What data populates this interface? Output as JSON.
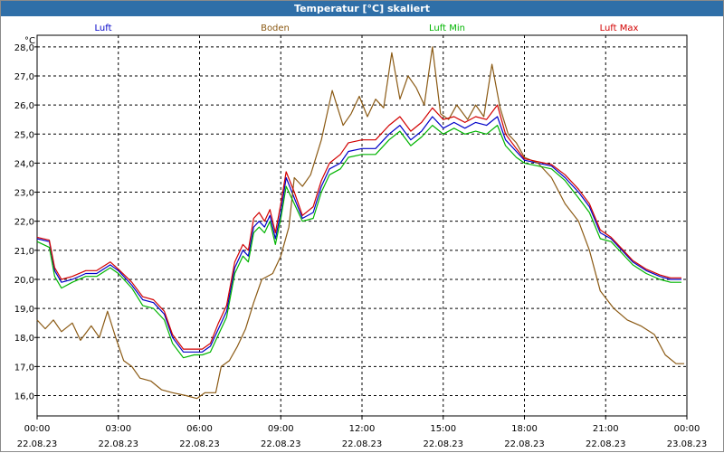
{
  "window": {
    "title": "Temperatur [°C] skaliert"
  },
  "chart_data": {
    "type": "line",
    "title": "Temperatur [°C] skaliert",
    "ylabel": "°C",
    "ylim": [
      15.3,
      28.4
    ],
    "xlim": [
      0,
      24
    ],
    "grid": true,
    "legend": "top",
    "yticks": [
      {
        "value": 16,
        "label": "16,0"
      },
      {
        "value": 17,
        "label": "17,0"
      },
      {
        "value": 18,
        "label": "18,0"
      },
      {
        "value": 19,
        "label": "19,0"
      },
      {
        "value": 20,
        "label": "20,0"
      },
      {
        "value": 21,
        "label": "21,0"
      },
      {
        "value": 22,
        "label": "22,0"
      },
      {
        "value": 23,
        "label": "23,0"
      },
      {
        "value": 24,
        "label": "24,0"
      },
      {
        "value": 25,
        "label": "25,0"
      },
      {
        "value": 26,
        "label": "26,0"
      },
      {
        "value": 27,
        "label": "27,0"
      },
      {
        "value": 28,
        "label": "28,0"
      }
    ],
    "xticks": [
      {
        "value": 0,
        "time": "00:00",
        "date": "22.08.23"
      },
      {
        "value": 3,
        "time": "03:00",
        "date": "22.08.23"
      },
      {
        "value": 6,
        "time": "06:00",
        "date": "22.08.23"
      },
      {
        "value": 9,
        "time": "09:00",
        "date": "22.08.23"
      },
      {
        "value": 12,
        "time": "12:00",
        "date": "22.08.23"
      },
      {
        "value": 15,
        "time": "15:00",
        "date": "22.08.23"
      },
      {
        "value": 18,
        "time": "18:00",
        "date": "22.08.23"
      },
      {
        "value": 21,
        "time": "21:00",
        "date": "22.08.23"
      },
      {
        "value": 24,
        "time": "00:00",
        "date": "23.08.23"
      }
    ],
    "series": [
      {
        "name": "Luft",
        "color": "#0000c8",
        "points": [
          [
            0,
            21.4
          ],
          [
            0.45,
            21.3
          ],
          [
            0.65,
            20.3
          ],
          [
            0.9,
            19.9
          ],
          [
            1.3,
            20.0
          ],
          [
            1.8,
            20.2
          ],
          [
            2.2,
            20.2
          ],
          [
            2.7,
            20.5
          ],
          [
            3.0,
            20.3
          ],
          [
            3.5,
            19.8
          ],
          [
            3.9,
            19.3
          ],
          [
            4.3,
            19.2
          ],
          [
            4.7,
            18.8
          ],
          [
            5.0,
            18.0
          ],
          [
            5.4,
            17.5
          ],
          [
            5.8,
            17.5
          ],
          [
            6.1,
            17.5
          ],
          [
            6.4,
            17.7
          ],
          [
            6.7,
            18.3
          ],
          [
            7.0,
            18.9
          ],
          [
            7.3,
            20.4
          ],
          [
            7.6,
            21.0
          ],
          [
            7.8,
            20.8
          ],
          [
            8.0,
            21.8
          ],
          [
            8.2,
            22.0
          ],
          [
            8.4,
            21.8
          ],
          [
            8.6,
            22.2
          ],
          [
            8.8,
            21.4
          ],
          [
            9.0,
            22.3
          ],
          [
            9.2,
            23.5
          ],
          [
            9.5,
            22.8
          ],
          [
            9.8,
            22.1
          ],
          [
            10.2,
            22.3
          ],
          [
            10.5,
            23.2
          ],
          [
            10.8,
            23.8
          ],
          [
            11.2,
            24.0
          ],
          [
            11.5,
            24.4
          ],
          [
            12.0,
            24.5
          ],
          [
            12.5,
            24.5
          ],
          [
            13.0,
            25.0
          ],
          [
            13.4,
            25.3
          ],
          [
            13.8,
            24.8
          ],
          [
            14.2,
            25.1
          ],
          [
            14.6,
            25.6
          ],
          [
            15.0,
            25.2
          ],
          [
            15.4,
            25.4
          ],
          [
            15.8,
            25.2
          ],
          [
            16.2,
            25.4
          ],
          [
            16.6,
            25.3
          ],
          [
            17.0,
            25.6
          ],
          [
            17.3,
            24.8
          ],
          [
            17.7,
            24.4
          ],
          [
            18.0,
            24.1
          ],
          [
            18.5,
            24.0
          ],
          [
            19.0,
            23.9
          ],
          [
            19.5,
            23.5
          ],
          [
            20.0,
            23.0
          ],
          [
            20.4,
            22.5
          ],
          [
            20.8,
            21.6
          ],
          [
            21.2,
            21.4
          ],
          [
            21.6,
            21.0
          ],
          [
            22.0,
            20.6
          ],
          [
            22.5,
            20.3
          ],
          [
            23.0,
            20.1
          ],
          [
            23.4,
            20.0
          ],
          [
            23.8,
            20.0
          ]
        ]
      },
      {
        "name": "Boden",
        "color": "#8b5a14",
        "points": [
          [
            0,
            18.6
          ],
          [
            0.3,
            18.3
          ],
          [
            0.6,
            18.6
          ],
          [
            0.9,
            18.2
          ],
          [
            1.3,
            18.5
          ],
          [
            1.6,
            17.9
          ],
          [
            2.0,
            18.4
          ],
          [
            2.3,
            18.0
          ],
          [
            2.6,
            18.9
          ],
          [
            2.9,
            18.0
          ],
          [
            3.2,
            17.2
          ],
          [
            3.5,
            17.0
          ],
          [
            3.8,
            16.6
          ],
          [
            4.2,
            16.5
          ],
          [
            4.6,
            16.2
          ],
          [
            5.0,
            16.1
          ],
          [
            5.5,
            16.0
          ],
          [
            5.9,
            15.9
          ],
          [
            6.2,
            16.1
          ],
          [
            6.6,
            16.1
          ],
          [
            6.8,
            17.0
          ],
          [
            7.1,
            17.2
          ],
          [
            7.4,
            17.7
          ],
          [
            7.7,
            18.3
          ],
          [
            8.0,
            19.2
          ],
          [
            8.3,
            20.0
          ],
          [
            8.7,
            20.2
          ],
          [
            9.0,
            20.8
          ],
          [
            9.3,
            21.8
          ],
          [
            9.5,
            23.5
          ],
          [
            9.8,
            23.2
          ],
          [
            10.1,
            23.6
          ],
          [
            10.5,
            24.8
          ],
          [
            10.9,
            26.5
          ],
          [
            11.3,
            25.3
          ],
          [
            11.6,
            25.7
          ],
          [
            11.9,
            26.3
          ],
          [
            12.2,
            25.6
          ],
          [
            12.5,
            26.2
          ],
          [
            12.8,
            25.9
          ],
          [
            13.1,
            27.8
          ],
          [
            13.4,
            26.2
          ],
          [
            13.7,
            27.0
          ],
          [
            14.0,
            26.6
          ],
          [
            14.3,
            26.0
          ],
          [
            14.6,
            28.0
          ],
          [
            14.9,
            25.7
          ],
          [
            15.2,
            25.5
          ],
          [
            15.5,
            26.0
          ],
          [
            15.9,
            25.5
          ],
          [
            16.2,
            26.0
          ],
          [
            16.5,
            25.6
          ],
          [
            16.8,
            27.4
          ],
          [
            17.1,
            25.9
          ],
          [
            17.4,
            25.0
          ],
          [
            17.7,
            24.7
          ],
          [
            18.0,
            24.2
          ],
          [
            18.5,
            24.0
          ],
          [
            19.0,
            23.5
          ],
          [
            19.5,
            22.6
          ],
          [
            20.0,
            22.0
          ],
          [
            20.4,
            21.0
          ],
          [
            20.8,
            19.6
          ],
          [
            21.3,
            19.0
          ],
          [
            21.8,
            18.6
          ],
          [
            22.3,
            18.4
          ],
          [
            22.8,
            18.1
          ],
          [
            23.2,
            17.4
          ],
          [
            23.6,
            17.1
          ],
          [
            23.9,
            17.1
          ]
        ]
      },
      {
        "name": "Luft Min",
        "color": "#00b400",
        "points": [
          [
            0,
            21.3
          ],
          [
            0.45,
            21.1
          ],
          [
            0.65,
            20.1
          ],
          [
            0.9,
            19.7
          ],
          [
            1.3,
            19.9
          ],
          [
            1.8,
            20.1
          ],
          [
            2.2,
            20.1
          ],
          [
            2.7,
            20.4
          ],
          [
            3.0,
            20.2
          ],
          [
            3.5,
            19.7
          ],
          [
            3.9,
            19.1
          ],
          [
            4.3,
            19.0
          ],
          [
            4.7,
            18.6
          ],
          [
            5.0,
            17.8
          ],
          [
            5.4,
            17.3
          ],
          [
            5.8,
            17.4
          ],
          [
            6.1,
            17.4
          ],
          [
            6.4,
            17.5
          ],
          [
            6.7,
            18.1
          ],
          [
            7.0,
            18.7
          ],
          [
            7.3,
            20.2
          ],
          [
            7.6,
            20.8
          ],
          [
            7.8,
            20.6
          ],
          [
            8.0,
            21.6
          ],
          [
            8.2,
            21.8
          ],
          [
            8.4,
            21.6
          ],
          [
            8.6,
            22.0
          ],
          [
            8.8,
            21.2
          ],
          [
            9.0,
            22.1
          ],
          [
            9.2,
            23.2
          ],
          [
            9.5,
            22.6
          ],
          [
            9.8,
            22.0
          ],
          [
            10.2,
            22.1
          ],
          [
            10.5,
            23.0
          ],
          [
            10.8,
            23.6
          ],
          [
            11.2,
            23.8
          ],
          [
            11.5,
            24.2
          ],
          [
            12.0,
            24.3
          ],
          [
            12.5,
            24.3
          ],
          [
            13.0,
            24.8
          ],
          [
            13.4,
            25.1
          ],
          [
            13.8,
            24.6
          ],
          [
            14.2,
            24.9
          ],
          [
            14.6,
            25.3
          ],
          [
            15.0,
            25.0
          ],
          [
            15.4,
            25.2
          ],
          [
            15.8,
            25.0
          ],
          [
            16.2,
            25.1
          ],
          [
            16.6,
            25.0
          ],
          [
            17.0,
            25.3
          ],
          [
            17.3,
            24.6
          ],
          [
            17.7,
            24.2
          ],
          [
            18.0,
            24.0
          ],
          [
            18.5,
            23.9
          ],
          [
            19.0,
            23.8
          ],
          [
            19.5,
            23.4
          ],
          [
            20.0,
            22.8
          ],
          [
            20.4,
            22.3
          ],
          [
            20.8,
            21.4
          ],
          [
            21.2,
            21.3
          ],
          [
            21.6,
            20.9
          ],
          [
            22.0,
            20.5
          ],
          [
            22.5,
            20.2
          ],
          [
            23.0,
            20.0
          ],
          [
            23.4,
            19.9
          ],
          [
            23.8,
            19.9
          ]
        ]
      },
      {
        "name": "Luft Max",
        "color": "#d20000",
        "points": [
          [
            0,
            21.45
          ],
          [
            0.45,
            21.35
          ],
          [
            0.65,
            20.4
          ],
          [
            0.9,
            20.0
          ],
          [
            1.3,
            20.1
          ],
          [
            1.8,
            20.3
          ],
          [
            2.2,
            20.3
          ],
          [
            2.7,
            20.6
          ],
          [
            3.0,
            20.35
          ],
          [
            3.5,
            19.9
          ],
          [
            3.9,
            19.4
          ],
          [
            4.3,
            19.3
          ],
          [
            4.7,
            18.9
          ],
          [
            5.0,
            18.1
          ],
          [
            5.4,
            17.6
          ],
          [
            5.8,
            17.6
          ],
          [
            6.1,
            17.6
          ],
          [
            6.4,
            17.8
          ],
          [
            6.7,
            18.5
          ],
          [
            7.0,
            19.1
          ],
          [
            7.3,
            20.6
          ],
          [
            7.6,
            21.2
          ],
          [
            7.8,
            21.0
          ],
          [
            8.0,
            22.1
          ],
          [
            8.2,
            22.3
          ],
          [
            8.4,
            22.0
          ],
          [
            8.6,
            22.4
          ],
          [
            8.8,
            21.6
          ],
          [
            9.0,
            22.6
          ],
          [
            9.2,
            23.7
          ],
          [
            9.5,
            23.0
          ],
          [
            9.8,
            22.2
          ],
          [
            10.2,
            22.5
          ],
          [
            10.5,
            23.4
          ],
          [
            10.8,
            24.0
          ],
          [
            11.2,
            24.3
          ],
          [
            11.5,
            24.7
          ],
          [
            12.0,
            24.8
          ],
          [
            12.5,
            24.8
          ],
          [
            13.0,
            25.3
          ],
          [
            13.4,
            25.6
          ],
          [
            13.8,
            25.1
          ],
          [
            14.2,
            25.4
          ],
          [
            14.6,
            25.9
          ],
          [
            15.0,
            25.5
          ],
          [
            15.4,
            25.6
          ],
          [
            15.8,
            25.4
          ],
          [
            16.2,
            25.6
          ],
          [
            16.6,
            25.5
          ],
          [
            17.0,
            26.0
          ],
          [
            17.3,
            25.0
          ],
          [
            17.7,
            24.5
          ],
          [
            18.0,
            24.15
          ],
          [
            18.5,
            24.05
          ],
          [
            19.0,
            23.95
          ],
          [
            19.5,
            23.6
          ],
          [
            20.0,
            23.1
          ],
          [
            20.4,
            22.6
          ],
          [
            20.8,
            21.7
          ],
          [
            21.2,
            21.45
          ],
          [
            21.6,
            21.05
          ],
          [
            22.0,
            20.65
          ],
          [
            22.5,
            20.35
          ],
          [
            23.0,
            20.15
          ],
          [
            23.4,
            20.05
          ],
          [
            23.8,
            20.05
          ]
        ]
      }
    ]
  }
}
